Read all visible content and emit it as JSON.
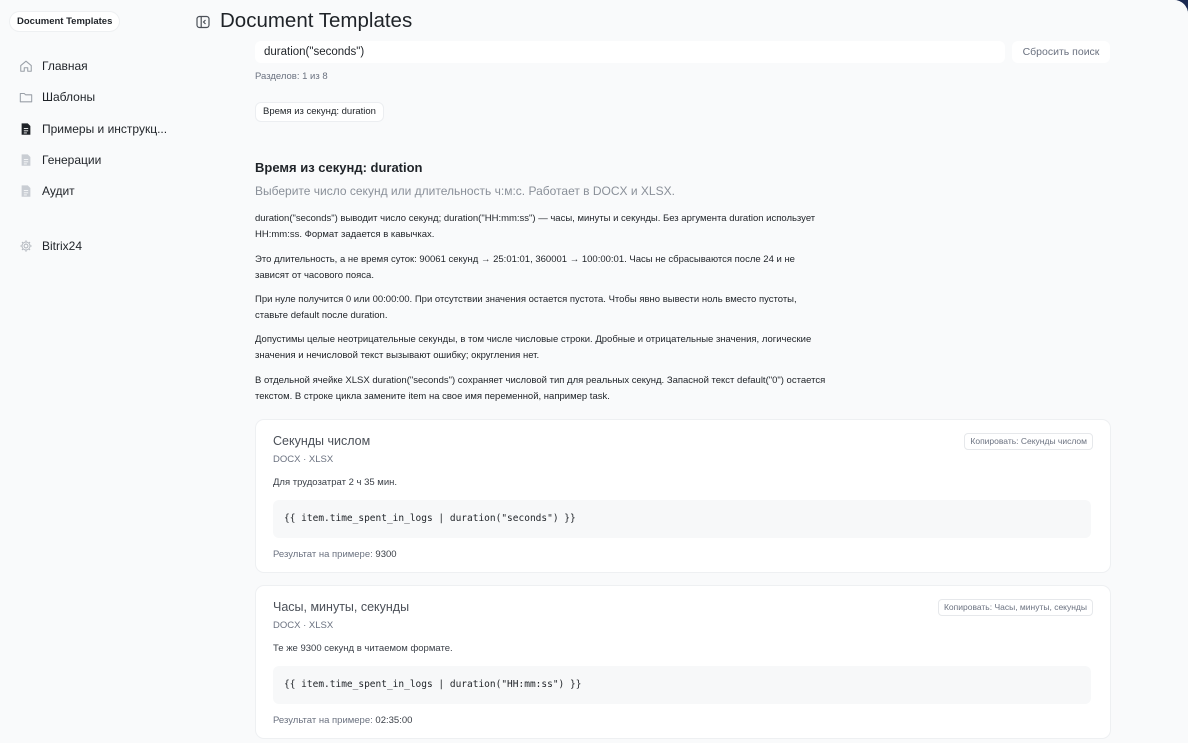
{
  "sidebar": {
    "brand": "Document Templates",
    "items": [
      {
        "label": "Главная",
        "icon": "home-icon"
      },
      {
        "label": "Шаблоны",
        "icon": "folder-icon"
      },
      {
        "label": "Примеры и инструкц...",
        "icon": "document-icon",
        "active": true
      },
      {
        "label": "Генерации",
        "icon": "file-icon"
      },
      {
        "label": "Аудит",
        "icon": "file-icon"
      },
      {
        "label": "Bitrix24",
        "icon": "gear-icon"
      }
    ]
  },
  "header": {
    "title": "Document Templates"
  },
  "search": {
    "value": "duration(\"seconds\")",
    "reset_label": "Сбросить поиск",
    "sections_count": "Разделов: 1 из 8"
  },
  "chips": [
    "Время из секунд: duration"
  ],
  "section": {
    "title": "Время из секунд: duration",
    "subtitle": "Выберите число секунд или длительность ч:м:с. Работает в DOCX и XLSX.",
    "paragraphs": [
      "duration(\"seconds\") выводит число секунд; duration(\"HH:mm:ss\") — часы, минуты и секунды. Без аргумента duration использует HH:mm:ss. Формат задается в кавычках.",
      "Это длительность, а не время суток: 90061 секунд → 25:01:01, 360001 → 100:00:01. Часы не сбрасываются после 24 и не зависят от часового пояса.",
      "При нуле получится 0 или 00:00:00. При отсутствии значения остается пустота. Чтобы явно вывести ноль вместо пустоты, ставьте default после duration.",
      "Допустимы целые неотрицательные секунды, в том числе числовые строки. Дробные и отрицательные значения, логические значения и нечисловой текст вызывают ошибку; округления нет.",
      "В отдельной ячейке XLSX duration(\"seconds\") сохраняет числовой тип для реальных секунд. Запасной текст default(\"0\") остается текстом. В строке цикла замените item на свое имя переменной, например task."
    ]
  },
  "examples": [
    {
      "title": "Секунды числом",
      "formats": "DOCX · XLSX",
      "description": "Для трудозатрат 2 ч 35 мин.",
      "code": "{{ item.time_spent_in_logs | duration(\"seconds\") }}",
      "result_label": "Результат на примере: ",
      "result_value": "9300",
      "copy_label": "Копировать: Секунды числом"
    },
    {
      "title": "Часы, минуты, секунды",
      "formats": "DOCX · XLSX",
      "description": "Те же 9300 секунд в читаемом формате.",
      "code": "{{ item.time_spent_in_logs | duration(\"HH:mm:ss\") }}",
      "result_label": "Результат на примере: ",
      "result_value": "02:35:00",
      "copy_label": "Копировать: Часы, минуты, секунды"
    }
  ]
}
